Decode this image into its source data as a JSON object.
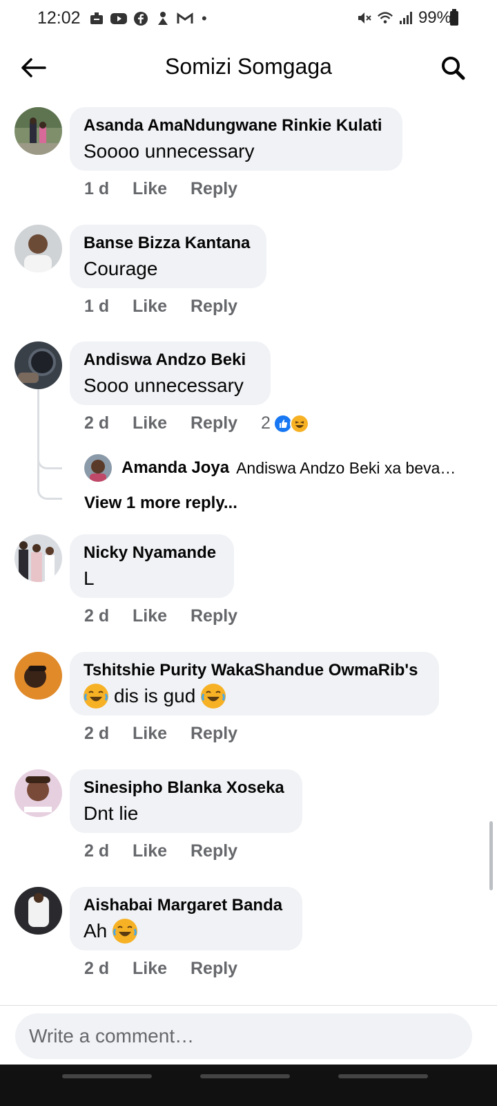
{
  "status_bar": {
    "time": "12:02",
    "dot": "•",
    "battery_percent": "99%"
  },
  "header": {
    "title": "Somizi Somgaga"
  },
  "comments": [
    {
      "name": "Asanda AmaNdungwane Rinkie Kulati",
      "text": "Soooo unnecessary",
      "time": "1 d",
      "like_label": "Like",
      "reply_label": "Reply"
    },
    {
      "name": "Banse Bizza Kantana",
      "text": "Courage",
      "time": "1 d",
      "like_label": "Like",
      "reply_label": "Reply"
    },
    {
      "name": "Andiswa Andzo Beki",
      "text": "Sooo unnecessary",
      "time": "2 d",
      "like_label": "Like",
      "reply_label": "Reply",
      "reaction_count": "2",
      "reply_preview": {
        "name": "Amanda Joya",
        "text": "Andiswa Andzo Beki xa beva…"
      },
      "view_more": "View 1 more reply..."
    },
    {
      "name": "Nicky Nyamande",
      "text": "L",
      "time": "2 d",
      "like_label": "Like",
      "reply_label": "Reply"
    },
    {
      "name": "Tshitshie Purity WakaShandue OwmaRib's",
      "text": "dis is gud",
      "time": "2 d",
      "like_label": "Like",
      "reply_label": "Reply"
    },
    {
      "name": "Sinesipho Blanka Xoseka",
      "text": "Dnt lie",
      "time": "2 d",
      "like_label": "Like",
      "reply_label": "Reply"
    },
    {
      "name": "Aishabai Margaret Banda",
      "text": "Ah",
      "time": "2 d",
      "like_label": "Like",
      "reply_label": "Reply"
    }
  ],
  "composer": {
    "placeholder": "Write a comment…"
  },
  "colors": {
    "bubble": "#f0f2f5",
    "secondary_text": "#65676b",
    "like_blue": "#1877f2",
    "haha_yellow": "#f7b125"
  }
}
